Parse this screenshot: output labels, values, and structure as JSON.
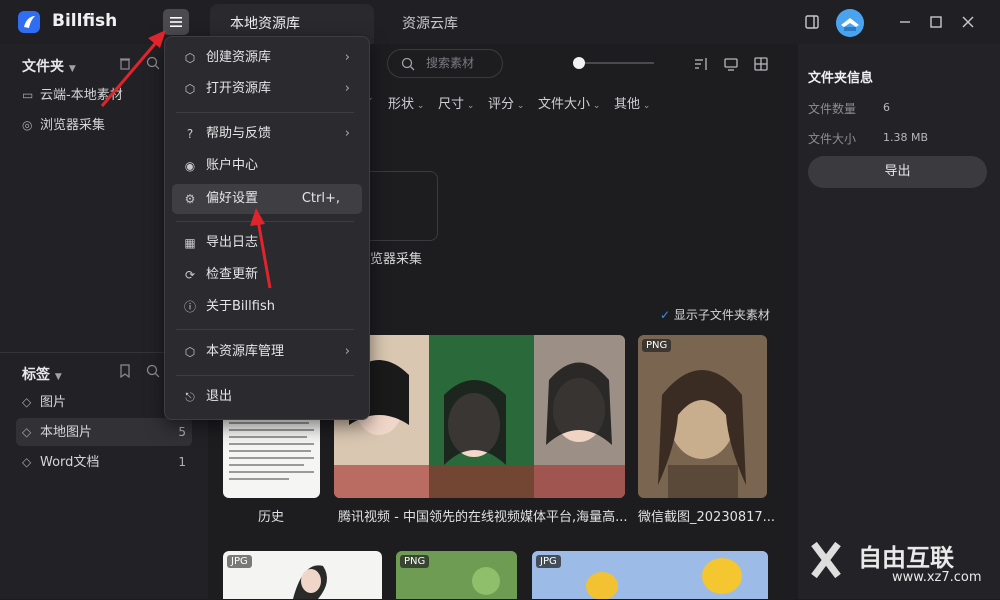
{
  "app": {
    "name": "Billfish"
  },
  "tabs": {
    "local": "本地资源库",
    "cloud": "资源云库"
  },
  "sidebar": {
    "folders_title": "文件夹",
    "folders": [
      {
        "label": "云端-本地素材",
        "icon": "cloud-drive-icon"
      },
      {
        "label": "浏览器采集",
        "icon": "compass-icon"
      }
    ],
    "tags_title": "标签",
    "tags": [
      {
        "label": "图片",
        "count": ""
      },
      {
        "label": "本地图片",
        "count": "5"
      },
      {
        "label": "Word文档",
        "count": "1"
      }
    ]
  },
  "toolbar": {
    "search_placeholder": "搜索素材"
  },
  "filters": [
    "形状",
    "尺寸",
    "评分",
    "文件大小",
    "其他"
  ],
  "folder_card_label": "览器采集",
  "show_subfolder": "显示子文件夹素材",
  "thumbnails": [
    {
      "caption": "历史",
      "badge": ""
    },
    {
      "caption": "腾讯视频 - 中国领先的在线视频媒体平台,海量高...",
      "badge": ""
    },
    {
      "caption": "微信截图_20230817...",
      "badge": "PNG"
    }
  ],
  "thumbnails_row2_badges": [
    "JPG",
    "PNG",
    "JPG"
  ],
  "right_panel": {
    "title": "文件夹信息",
    "count_label": "文件数量",
    "count_value": "6",
    "size_label": "文件大小",
    "size_value": "1.38 MB",
    "export_label": "导出"
  },
  "menu": {
    "items": [
      {
        "label": "创建资源库",
        "icon": "cube-icon",
        "arrow": "›",
        "shortcut": ""
      },
      {
        "label": "打开资源库",
        "icon": "cube-icon",
        "arrow": "›",
        "shortcut": ""
      },
      {
        "label": "帮助与反馈",
        "icon": "help-icon",
        "arrow": "›",
        "shortcut": ""
      },
      {
        "label": "账户中心",
        "icon": "user-icon",
        "arrow": "",
        "shortcut": ""
      },
      {
        "label": "偏好设置",
        "icon": "settings-icon",
        "arrow": "",
        "shortcut": "Ctrl+,"
      },
      {
        "label": "导出日志",
        "icon": "calendar-icon",
        "arrow": "",
        "shortcut": ""
      },
      {
        "label": "检查更新",
        "icon": "update-icon",
        "arrow": "",
        "shortcut": ""
      },
      {
        "label": "关于Billfish",
        "icon": "info-icon",
        "arrow": "",
        "shortcut": ""
      },
      {
        "label": "本资源库管理",
        "icon": "cube-icon",
        "arrow": "›",
        "shortcut": ""
      },
      {
        "label": "退出",
        "icon": "logout-icon",
        "arrow": "",
        "shortcut": ""
      }
    ]
  },
  "watermark": {
    "text": "自由互联",
    "url": "www.xz7.com"
  },
  "colors": {
    "accent": "#2f6ef2",
    "annotation_arrow": "#e0242b",
    "background": "#1c1c1f"
  }
}
